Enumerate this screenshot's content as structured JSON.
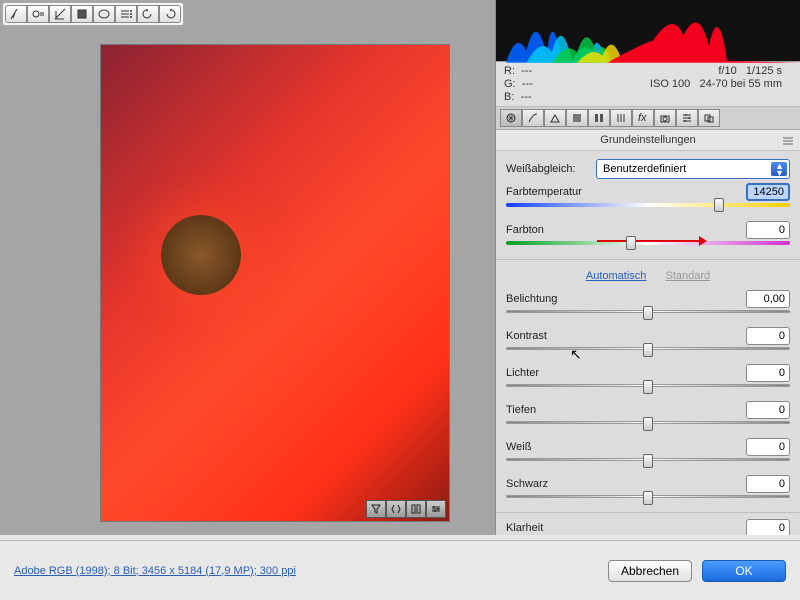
{
  "toolbar_icons": [
    "white-balance",
    "target-adjust",
    "crop",
    "straighten",
    "spot-heal",
    "list",
    "rotate-left",
    "rotate-right"
  ],
  "preview_tools": [
    "filter",
    "compare",
    "zoom",
    "adjust"
  ],
  "info": {
    "r": "R:",
    "r_val": "---",
    "g": "G:",
    "g_val": "---",
    "b": "B:",
    "b_val": "---",
    "aperture": "f/10",
    "shutter": "1/125 s",
    "iso": "ISO 100",
    "lens": "24-70 bei 55 mm"
  },
  "panel": {
    "title": "Grundeinstellungen",
    "wb_label": "Weißabgleich:",
    "wb_value": "Benutzerdefiniert",
    "temp_label": "Farbtemperatur",
    "temp_value": "14250",
    "tint_label": "Farbton",
    "tint_value": "0",
    "auto_link": "Automatisch",
    "standard_link": "Standard",
    "sliders": [
      {
        "label": "Belichtung",
        "value": "0,00",
        "pos": 50
      },
      {
        "label": "Kontrast",
        "value": "0",
        "pos": 50
      },
      {
        "label": "Lichter",
        "value": "0",
        "pos": 50
      },
      {
        "label": "Tiefen",
        "value": "0",
        "pos": 50
      },
      {
        "label": "Weiß",
        "value": "0",
        "pos": 50
      },
      {
        "label": "Schwarz",
        "value": "0",
        "pos": 50
      }
    ],
    "clarity_label": "Klarheit",
    "clarity_value": "0"
  },
  "footer": {
    "profile_link": "Adobe RGB (1998); 8 Bit; 3456 x 5184 (17,9 MP); 300 ppi",
    "cancel": "Abbrechen",
    "ok": "OK"
  }
}
